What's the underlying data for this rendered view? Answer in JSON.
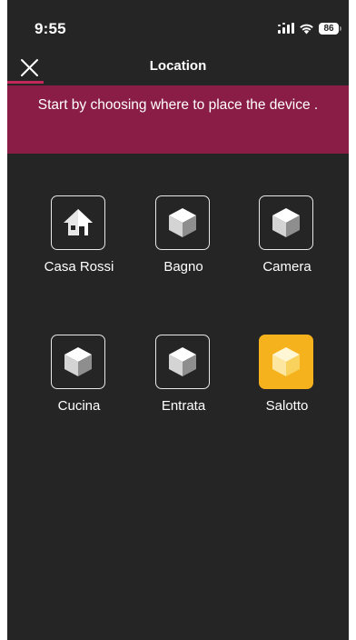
{
  "status_bar": {
    "time": "9:55",
    "battery": "86",
    "icons": [
      "signal-icon",
      "wifi-icon",
      "battery-icon"
    ]
  },
  "header": {
    "title": "Location",
    "close_icon": "close-icon"
  },
  "banner": {
    "text": "Start by choosing where to place the device .",
    "color": "#8a1d46"
  },
  "locations": [
    {
      "label": "Casa Rossi",
      "icon": "house-icon",
      "selected": false
    },
    {
      "label": "Bagno",
      "icon": "cube-icon",
      "selected": false
    },
    {
      "label": "Camera",
      "icon": "cube-icon",
      "selected": false
    },
    {
      "label": "Cucina",
      "icon": "cube-icon",
      "selected": false
    },
    {
      "label": "Entrata",
      "icon": "cube-icon",
      "selected": false
    },
    {
      "label": "Salotto",
      "icon": "cube-icon",
      "selected": true
    }
  ],
  "colors": {
    "background": "#252525",
    "accent": "#c4275a",
    "selected": "#f5b21c"
  }
}
